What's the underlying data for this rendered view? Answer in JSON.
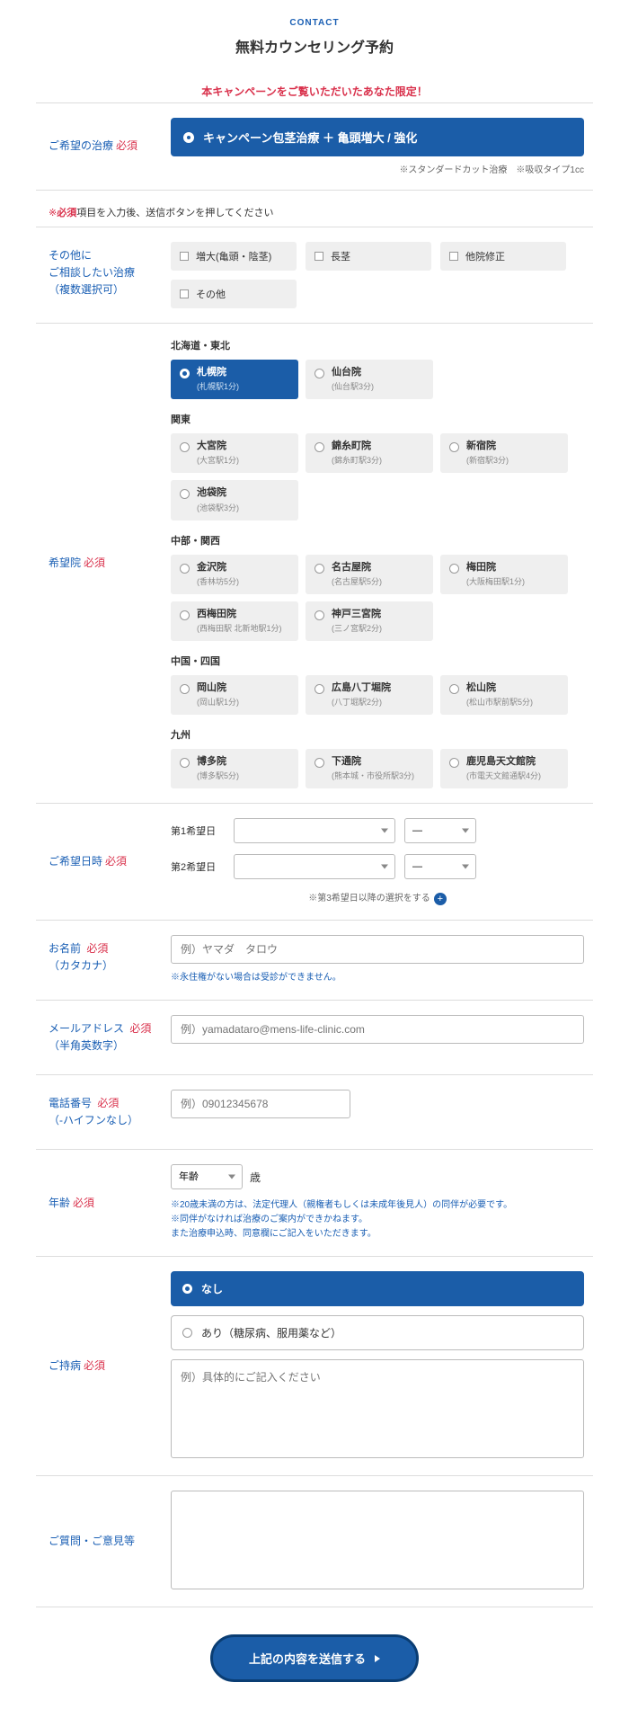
{
  "header": {
    "contact": "CONTACT",
    "title": "無料カウンセリング予約"
  },
  "campaign_note": "本キャンペーンをご覧いただいたあなた限定！",
  "required_label": "必須",
  "sections": {
    "treatment": {
      "label": "ご希望の治療",
      "selected": "キャンペーン包茎治療 ＋ 亀頭増大 / 強化",
      "fineprint": "※スタンダードカット治療　※吸収タイプ1cc"
    },
    "instruct": {
      "prefix": "※",
      "bold": "必須",
      "rest": "項目を入力後、送信ボタンを押してください"
    },
    "other": {
      "label1": "その他に",
      "label2": "ご相談したい治療",
      "label3": "（複数選択可）",
      "items": [
        "増大(亀頭・陰茎)",
        "長茎",
        "他院修正",
        "その他"
      ]
    },
    "clinics": {
      "label": "希望院",
      "regions": [
        {
          "name": "北海道・東北",
          "clinics": [
            {
              "name": "札幌院",
              "sub": "(札幌駅1分)",
              "on": true
            },
            {
              "name": "仙台院",
              "sub": "(仙台駅3分)"
            }
          ]
        },
        {
          "name": "関東",
          "clinics": [
            {
              "name": "大宮院",
              "sub": "(大宮駅1分)"
            },
            {
              "name": "錦糸町院",
              "sub": "(錦糸町駅3分)"
            },
            {
              "name": "新宿院",
              "sub": "(新宿駅3分)"
            },
            {
              "name": "池袋院",
              "sub": "(池袋駅3分)"
            }
          ]
        },
        {
          "name": "中部・関西",
          "clinics": [
            {
              "name": "金沢院",
              "sub": "(香林坊5分)"
            },
            {
              "name": "名古屋院",
              "sub": "(名古屋駅5分)"
            },
            {
              "name": "梅田院",
              "sub": "(大阪梅田駅1分)"
            },
            {
              "name": "西梅田院",
              "sub": "(西梅田駅 北新地駅1分)"
            },
            {
              "name": "神戸三宮院",
              "sub": "(三ノ宮駅2分)"
            }
          ]
        },
        {
          "name": "中国・四国",
          "clinics": [
            {
              "name": "岡山院",
              "sub": "(岡山駅1分)"
            },
            {
              "name": "広島八丁堀院",
              "sub": "(八丁堀駅2分)"
            },
            {
              "name": "松山院",
              "sub": "(松山市駅前駅5分)"
            }
          ]
        },
        {
          "name": "九州",
          "clinics": [
            {
              "name": "博多院",
              "sub": "(博多駅5分)"
            },
            {
              "name": "下通院",
              "sub": "(熊本城・市役所駅3分)"
            },
            {
              "name": "鹿児島天文館院",
              "sub": "(市電天文館通駅4分)"
            }
          ]
        }
      ]
    },
    "dates": {
      "label": "ご希望日時",
      "row1": "第1希望日",
      "row2": "第2希望日",
      "dash": "—",
      "add_note": "※第3希望日以降の選択をする"
    },
    "name": {
      "label1": "お名前",
      "label2": "（カタカナ）",
      "placeholder": "例）ヤマダ　タロウ",
      "note": "※永住権がない場合は受診ができません。"
    },
    "email": {
      "label1": "メールアドレス",
      "label2": "（半角英数字）",
      "placeholder": "例）yamadataro@mens-life-clinic.com"
    },
    "phone": {
      "label1": "電話番号",
      "label2": "（-ハイフンなし）",
      "placeholder": "例）09012345678"
    },
    "age": {
      "label": "年齢",
      "sel": "年齢",
      "unit": "歳",
      "note1": "※20歳未満の方は、法定代理人（親権者もしくは未成年後見人）の同伴が必要です。",
      "note2": "※同伴がなければ治療のご案内ができかねます。",
      "note3": "また治療申込時、同意欄にご記入をいただきます。"
    },
    "illness": {
      "label": "ご持病",
      "none": "なし",
      "yes": "あり（糖尿病、服用薬など）",
      "placeholder": "例）具体的にご記入ください"
    },
    "question": {
      "label": "ご質問・ご意見等"
    }
  },
  "submit": "上記の内容を送信する"
}
